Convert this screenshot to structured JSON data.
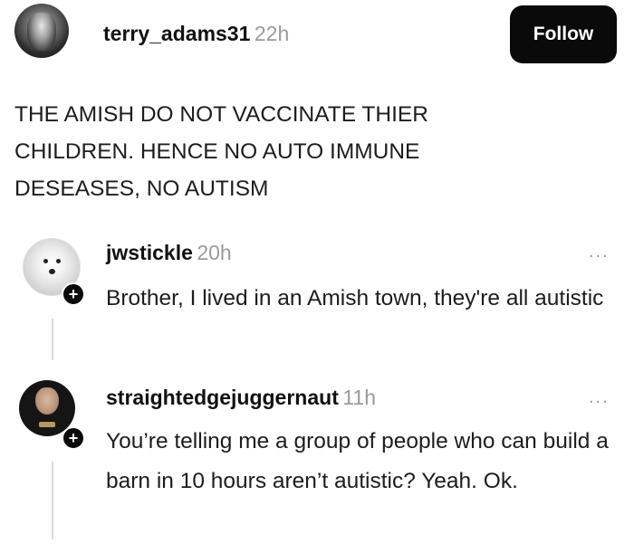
{
  "post": {
    "username": "terry_adams31",
    "time": "22h",
    "follow_label": "Follow",
    "text": "THE AMISH DO NOT VACCINATE THIER\nCHILDREN. HENCE NO AUTO IMMUNE\nDESEASES,  NO AUTISM"
  },
  "comments": [
    {
      "username": "jwstickle",
      "time": "20h",
      "more": "...",
      "text": "Brother, I lived in an Amish town, they're all autistic"
    },
    {
      "username": "straightedgejuggernaut",
      "time": "11h",
      "more": "...",
      "text": "You’re telling me a group of people who can build a barn in 10 hours aren’t autistic? Yeah. Ok."
    }
  ],
  "icons": {
    "plus": "+"
  }
}
